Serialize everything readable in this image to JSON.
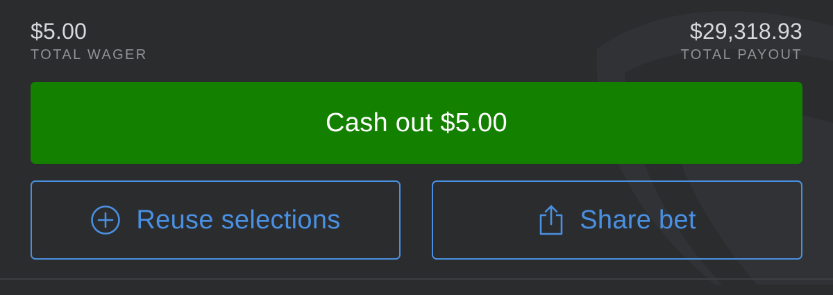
{
  "totals": {
    "wager_amount": "$5.00",
    "wager_label": "TOTAL WAGER",
    "payout_amount": "$29,318.93",
    "payout_label": "TOTAL PAYOUT"
  },
  "cashout": {
    "label": "Cash out $5.00"
  },
  "actions": {
    "reuse_label": "Reuse selections",
    "reuse_icon": "plus-circle-icon",
    "share_label": "Share bet",
    "share_icon": "share-icon"
  },
  "colors": {
    "background": "#2b2c2e",
    "cashout_green": "#148000",
    "accent_blue": "#4a90e2",
    "amount_text": "#d6d8dc",
    "label_text": "#8f9297"
  }
}
